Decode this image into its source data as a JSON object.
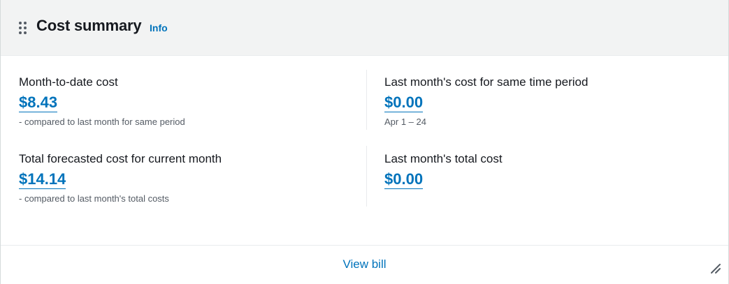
{
  "header": {
    "title": "Cost summary",
    "info_link": "Info"
  },
  "metrics": {
    "month_to_date": {
      "label": "Month-to-date cost",
      "value": "$8.43",
      "note": "- compared to last month for same period"
    },
    "last_month_same_period": {
      "label": "Last month's cost for same time period",
      "value": "$0.00",
      "note": "Apr 1 – 24"
    },
    "forecast_current_month": {
      "label": "Total forecasted cost for current month",
      "value": "$14.14",
      "note": "- compared to last month's total costs"
    },
    "last_month_total": {
      "label": "Last month's total cost",
      "value": "$0.00"
    }
  },
  "footer": {
    "view_bill_label": "View bill"
  },
  "icons": {
    "drag": "drag-handle-icon",
    "resize": "resize-handle-icon"
  },
  "colors": {
    "link": "#0073bb",
    "header_bg": "#f2f3f3",
    "text": "#16191f",
    "muted": "#545b64"
  }
}
